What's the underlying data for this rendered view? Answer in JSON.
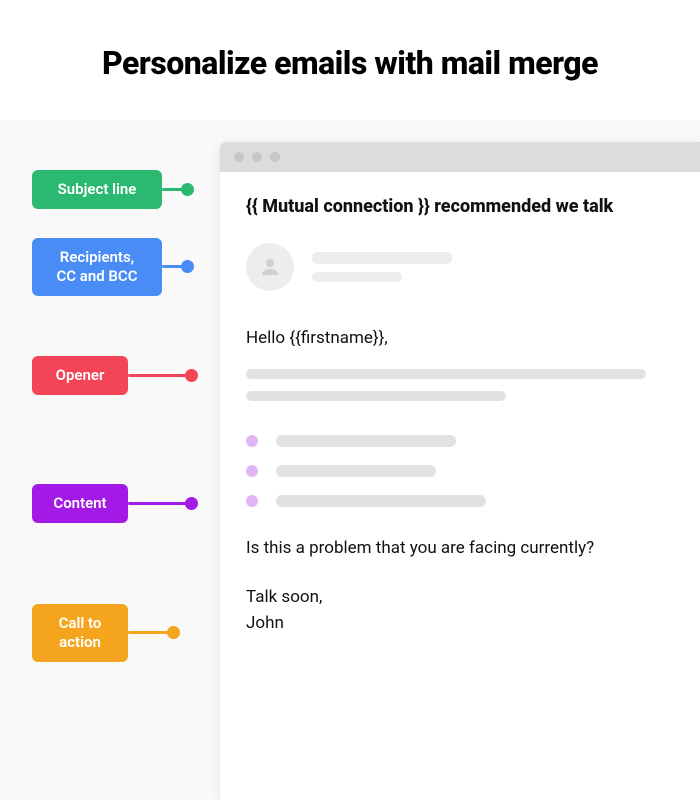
{
  "title": "Personalize emails with mail merge",
  "labels": {
    "subject": "Subject line",
    "recipients": "Recipients,\nCC and BCC",
    "opener": "Opener",
    "content": "Content",
    "cta": "Call to action"
  },
  "email": {
    "subject": "{{ Mutual connection }} recommended we talk",
    "greeting": "Hello {{firstname}},",
    "cta_question": "Is this a problem that you are facing currently?",
    "signoff": "Talk soon,",
    "signature": "John"
  },
  "colors": {
    "subject": "#2bb870",
    "recipients": "#4a8cf6",
    "opener": "#f44458",
    "content": "#a319e6",
    "cta": "#f5a51d"
  }
}
